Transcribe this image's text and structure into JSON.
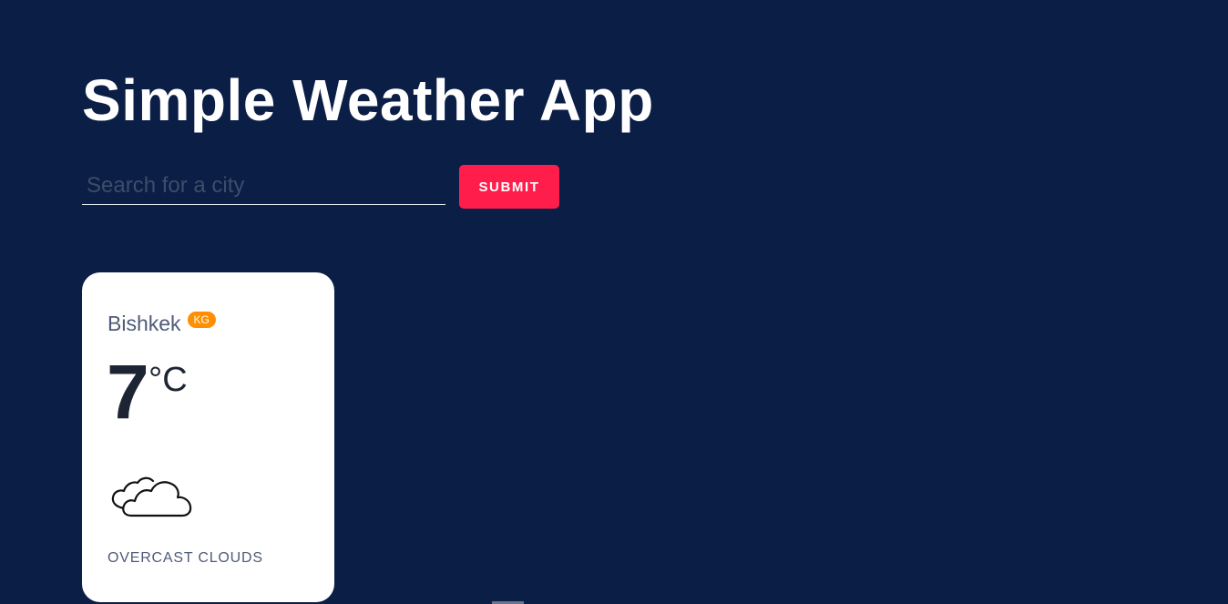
{
  "header": {
    "title": "Simple Weather App"
  },
  "search": {
    "placeholder": "Search for a city",
    "value": "",
    "submit_label": "SUBMIT"
  },
  "weather_card": {
    "city": "Bishkek",
    "country_code": "KG",
    "temperature": "7",
    "unit": "°C",
    "icon": "overcast-clouds-icon",
    "description": "OVERCAST CLOUDS"
  },
  "colors": {
    "background": "#0b1e45",
    "accent": "#ff1e4b",
    "badge": "#ff8f00",
    "card": "#ffffff"
  }
}
